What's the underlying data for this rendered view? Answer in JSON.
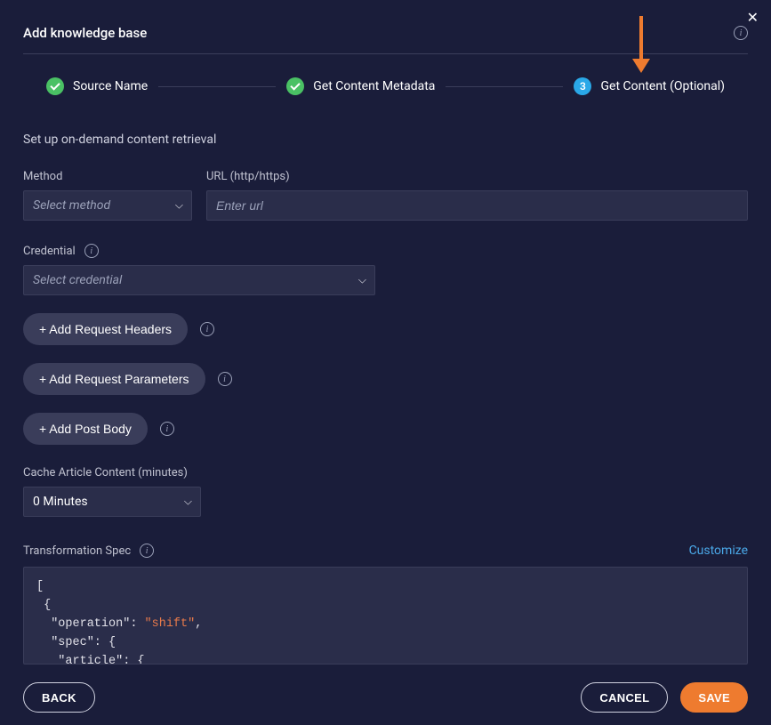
{
  "modal": {
    "title": "Add knowledge base"
  },
  "stepper": {
    "steps": [
      {
        "label": "Source Name",
        "state": "done"
      },
      {
        "label": "Get Content Metadata",
        "state": "done"
      },
      {
        "label": "Get Content (Optional)",
        "state": "current",
        "number": "3"
      }
    ]
  },
  "section": {
    "description": "Set up on-demand content retrieval"
  },
  "fields": {
    "method": {
      "label": "Method",
      "placeholder": "Select method"
    },
    "url": {
      "label": "URL (http/https)",
      "placeholder": "Enter url"
    },
    "credential": {
      "label": "Credential",
      "placeholder": "Select credential"
    },
    "cache": {
      "label": "Cache Article Content (minutes)",
      "value": "0 Minutes"
    },
    "transformation": {
      "label": "Transformation Spec",
      "customize": "Customize"
    }
  },
  "buttons": {
    "add_headers": "+ Add Request Headers",
    "add_params": "+ Add Request Parameters",
    "add_body": "+ Add Post Body",
    "back": "BACK",
    "cancel": "CANCEL",
    "save": "SAVE"
  },
  "code": {
    "l1": "[",
    "l2": " {",
    "l3a": "  \"operation\": ",
    "l3b": "\"shift\"",
    "l3c": ",",
    "l4": "  \"spec\": {",
    "l5": "   \"article\": {"
  }
}
